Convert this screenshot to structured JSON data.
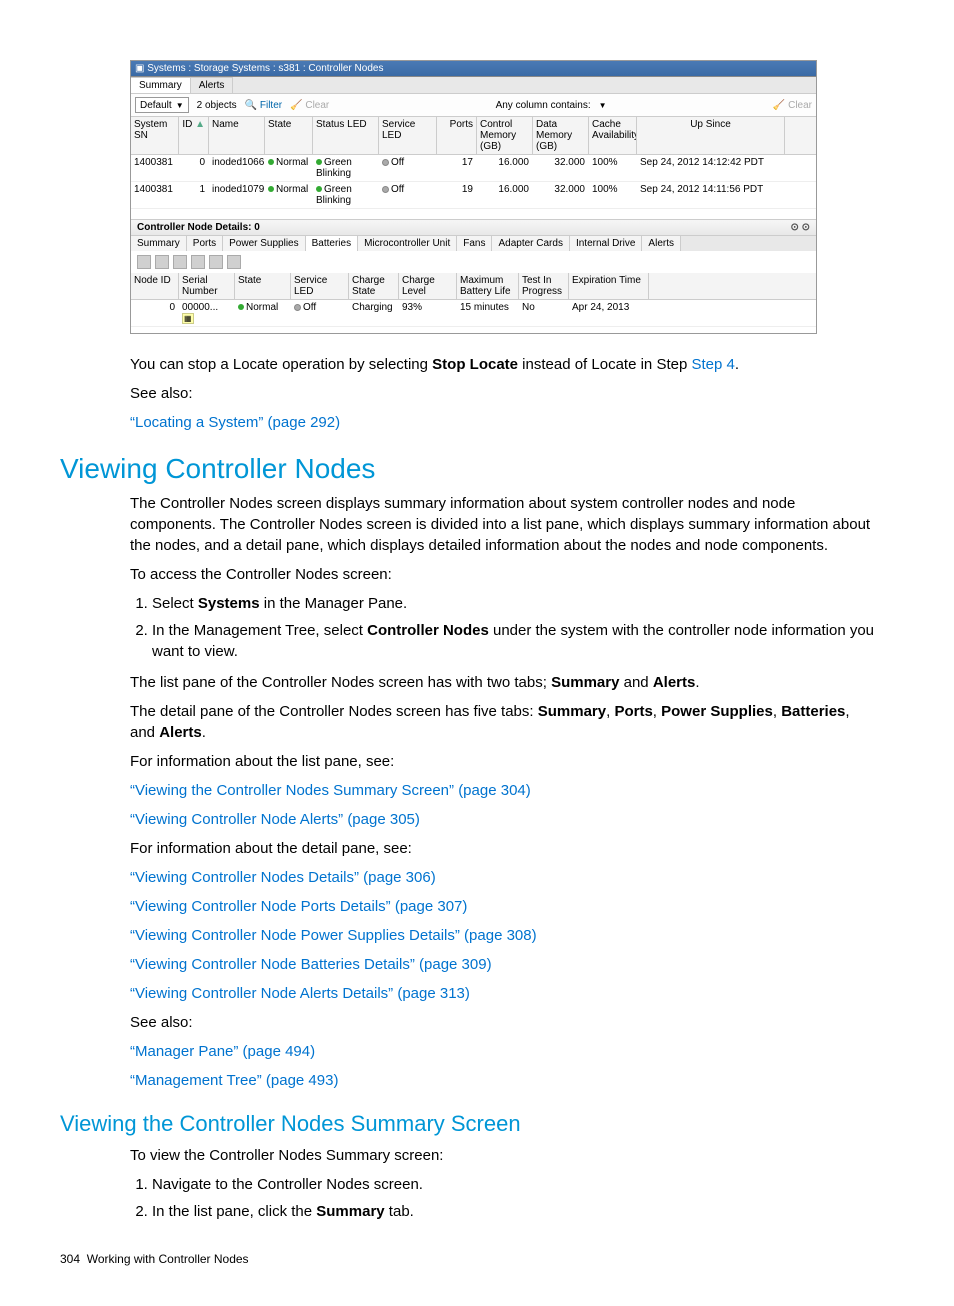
{
  "screenshot": {
    "breadcrumb": "Systems : Storage Systems : s381 : Controller Nodes",
    "tabs": [
      "Summary",
      "Alerts"
    ],
    "toolbar": {
      "view": "Default",
      "count": "2 objects",
      "filter": "Filter",
      "clear": "Clear",
      "search_label": "Any column contains:",
      "search_clear": "Clear"
    },
    "columns": [
      "System SN",
      "ID",
      "Name",
      "State",
      "Status LED",
      "Service LED",
      "Ports",
      "Control Memory (GB)",
      "Data Memory (GB)",
      "Cache Availability",
      "Up Since"
    ],
    "rows": [
      {
        "sn": "1400381",
        "id": "0",
        "name": "inoded1066",
        "state": "Normal",
        "status": "Green Blinking",
        "svc": "Off",
        "ports": "17",
        "ctrl": "16.000",
        "data": "32.000",
        "cache": "100%",
        "up": "Sep 24, 2012 14:12:42 PDT"
      },
      {
        "sn": "1400381",
        "id": "1",
        "name": "inoded1079",
        "state": "Normal",
        "status": "Green Blinking",
        "svc": "Off",
        "ports": "19",
        "ctrl": "16.000",
        "data": "32.000",
        "cache": "100%",
        "up": "Sep 24, 2012 14:11:56 PDT"
      }
    ],
    "detail_head": "Controller Node Details: 0",
    "subtabs": [
      "Summary",
      "Ports",
      "Power Supplies",
      "Batteries",
      "Microcontroller Unit",
      "Fans",
      "Adapter Cards",
      "Internal Drive",
      "Alerts"
    ],
    "dcolumns": [
      "Node ID",
      "Serial Number",
      "State",
      "Service LED",
      "Charge State",
      "Charge Level",
      "Maximum Battery Life",
      "Test In Progress",
      "Expiration Time"
    ],
    "drow": {
      "nid": "0",
      "sn": "00000...",
      "state": "Normal",
      "svc": "Off",
      "cs": "Charging",
      "cl": "93%",
      "ml": "15 minutes",
      "tp": "No",
      "exp": "Apr 24, 2013"
    }
  },
  "doc": {
    "para1_a": "You can stop a Locate operation by selecting ",
    "para1_b": "Stop Locate",
    "para1_c": " instead of Locate in Step ",
    "para1_link": "Step 4",
    "para1_d": ".",
    "see_also": "See also:",
    "link_locating": "“Locating a System” (page 292)",
    "h1": "Viewing Controller Nodes",
    "p_overview": "The Controller Nodes screen displays summary information about system controller nodes and node components. The Controller Nodes screen is divided into a list pane, which displays summary information about the nodes, and a detail pane, which displays detailed information about the nodes and node components.",
    "p_access": "To access the Controller Nodes screen:",
    "ol1_1a": "Select ",
    "ol1_1b": "Systems",
    "ol1_1c": " in the Manager Pane.",
    "ol1_2a": "In the Management Tree, select ",
    "ol1_2b": "Controller Nodes",
    "ol1_2c": " under the system with the controller node information you want to view.",
    "p_list_a": "The list pane of the Controller Nodes screen has with two tabs; ",
    "p_list_summary": "Summary",
    "p_list_and": " and ",
    "p_list_alerts": "Alerts",
    "p_list_end": ".",
    "p_detail_a": "The detail pane of the Controller Nodes screen has five tabs: ",
    "p_detail_s": "Summary",
    "p_detail_c1": ", ",
    "p_detail_p": "Ports",
    "p_detail_c2": ", ",
    "p_detail_ps": "Power Supplies",
    "p_detail_c3": ", ",
    "p_detail_b": "Batteries",
    "p_detail_c4": ", and ",
    "p_detail_al": "Alerts",
    "p_detail_end": ".",
    "p_info_list": "For information about the list pane, see:",
    "link_summary": "“Viewing the Controller Nodes Summary Screen” (page 304)",
    "link_alerts": "“Viewing Controller Node Alerts” (page 305)",
    "p_info_detail": "For information about the detail pane, see:",
    "link_details": "“Viewing Controller Nodes Details” (page 306)",
    "link_ports": "“Viewing Controller Node Ports Details” (page 307)",
    "link_ps": "“Viewing Controller Node Power Supplies Details” (page 308)",
    "link_batt": "“Viewing Controller Node Batteries Details” (page 309)",
    "link_alerts_d": "“Viewing Controller Node Alerts Details” (page 313)",
    "link_mgr": "“Manager Pane” (page 494)",
    "link_tree": "“Management Tree” (page 493)",
    "h2": "Viewing the Controller Nodes Summary Screen",
    "p_view": "To view the Controller Nodes Summary screen:",
    "ol2_1": "Navigate to the Controller Nodes screen.",
    "ol2_2a": "In the list pane, click the ",
    "ol2_2b": "Summary",
    "ol2_2c": " tab.",
    "footer_page": "304",
    "footer_title": "Working with Controller Nodes"
  }
}
